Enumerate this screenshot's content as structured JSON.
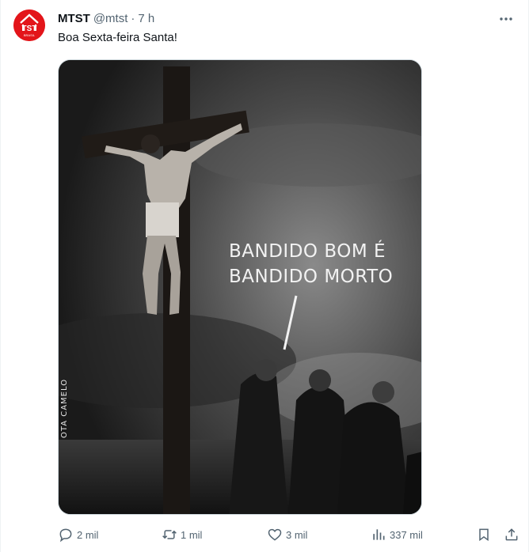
{
  "post": {
    "author_name": "MTST",
    "handle": "@mtst",
    "separator": "·",
    "time": "7 h",
    "text": "Boa Sexta-feira Santa!",
    "avatar_text_top": "TST",
    "avatar_text_bottom": "BRASIL"
  },
  "media": {
    "speech_line1": "BANDIDO BOM É",
    "speech_line2": "BANDIDO MORTO",
    "signature": "OTA CAMELO"
  },
  "actions": {
    "replies": "2 mil",
    "reposts": "1 mil",
    "likes": "3 mil",
    "views": "337 mil"
  },
  "colors": {
    "brand": "#e3151a",
    "text_primary": "#0f1419",
    "text_secondary": "#536471",
    "border": "#cfd9de"
  }
}
